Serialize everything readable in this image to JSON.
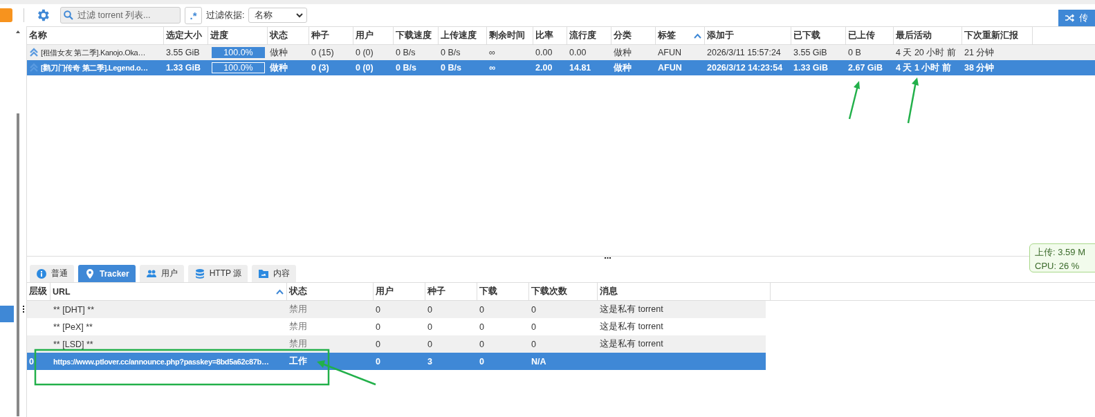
{
  "toolbar": {
    "search": {
      "placeholder": "过滤 torrent 列表..."
    },
    "regex_button": ".*",
    "filter_label": "过滤依据:",
    "filter_by": "名称",
    "right_button": "传"
  },
  "torrents": {
    "columns": [
      {
        "label": "名称",
        "kind": "name"
      },
      {
        "label": "选定大小",
        "kind": "text"
      },
      {
        "label": "进度",
        "kind": "progress"
      },
      {
        "label": "状态",
        "kind": "text"
      },
      {
        "label": "种子",
        "kind": "text"
      },
      {
        "label": "用户",
        "kind": "text"
      },
      {
        "label": "下载速度",
        "kind": "text"
      },
      {
        "label": "上传速度",
        "kind": "text"
      },
      {
        "label": "剩余时间",
        "kind": "text"
      },
      {
        "label": "比率",
        "kind": "text"
      },
      {
        "label": "流行度",
        "kind": "text"
      },
      {
        "label": "分类",
        "kind": "text"
      },
      {
        "label": "标签",
        "kind": "text",
        "sorted": true
      },
      {
        "label": "添加于",
        "kind": "text"
      },
      {
        "label": "已下载",
        "kind": "text"
      },
      {
        "label": "已上传",
        "kind": "text"
      },
      {
        "label": "最后活动",
        "kind": "text"
      },
      {
        "label": "下次重新汇报",
        "kind": "text"
      }
    ],
    "rows": [
      {
        "selected": false,
        "level": 1.0,
        "cells": [
          "[租借女友 第二季].Kanojo.Oka…",
          "3.55 GiB",
          "100.0%",
          "做种",
          "0 (15)",
          "0 (0)",
          "0 B/s",
          "0 B/s",
          "∞",
          "0.00",
          "0.00",
          "做种",
          "AFUN",
          "2026/3/11 15:57:24",
          "3.55 GiB",
          "0 B",
          "4 天 20 小时 前",
          "21 分钟"
        ]
      },
      {
        "selected": true,
        "level": 1.0,
        "cells": [
          "[鹳刀门传奇 第二季].Legend.o…",
          "1.33 GiB",
          "100.0%",
          "做种",
          "0 (3)",
          "0 (0)",
          "0 B/s",
          "0 B/s",
          "∞",
          "2.00",
          "14.81",
          "做种",
          "AFUN",
          "2026/3/12 14:23:54",
          "1.33 GiB",
          "2.67 GiB",
          "4 天 1 小时 前",
          "38 分钟"
        ]
      }
    ]
  },
  "detail_tabs": [
    {
      "label": "普通",
      "kind": "info",
      "selected": false
    },
    {
      "label": "Tracker",
      "kind": "tracker",
      "selected": true
    },
    {
      "label": "用户",
      "kind": "peers",
      "selected": false
    },
    {
      "label": "HTTP 源",
      "kind": "http",
      "selected": false
    },
    {
      "label": "内容",
      "kind": "content",
      "selected": false
    }
  ],
  "trackers": {
    "columns": [
      {
        "label": "层级"
      },
      {
        "label": "URL",
        "sorted": true
      },
      {
        "label": "状态"
      },
      {
        "label": "用户"
      },
      {
        "label": "种子"
      },
      {
        "label": "下载"
      },
      {
        "label": "下载次数"
      },
      {
        "label": "消息"
      }
    ],
    "rows": [
      {
        "selected": false,
        "disabled": true,
        "cells": [
          "",
          "** [DHT] **",
          "禁用",
          "0",
          "0",
          "0",
          "0",
          "这是私有 torrent"
        ]
      },
      {
        "selected": false,
        "disabled": true,
        "cells": [
          "",
          "** [PeX] **",
          "禁用",
          "0",
          "0",
          "0",
          "0",
          "这是私有 torrent"
        ]
      },
      {
        "selected": false,
        "disabled": true,
        "cells": [
          "",
          "** [LSD] **",
          "禁用",
          "0",
          "0",
          "0",
          "0",
          "这是私有 torrent"
        ]
      },
      {
        "selected": true,
        "disabled": false,
        "cells": [
          "0",
          "https://www.ptlover.cc/announce.php?passkey=8bd5a62c87b…",
          "工作",
          "0",
          "3",
          "0",
          "N/A",
          ""
        ]
      }
    ]
  },
  "status_popup": [
    "上传: 3.59 M",
    "CPU: 26 %"
  ]
}
